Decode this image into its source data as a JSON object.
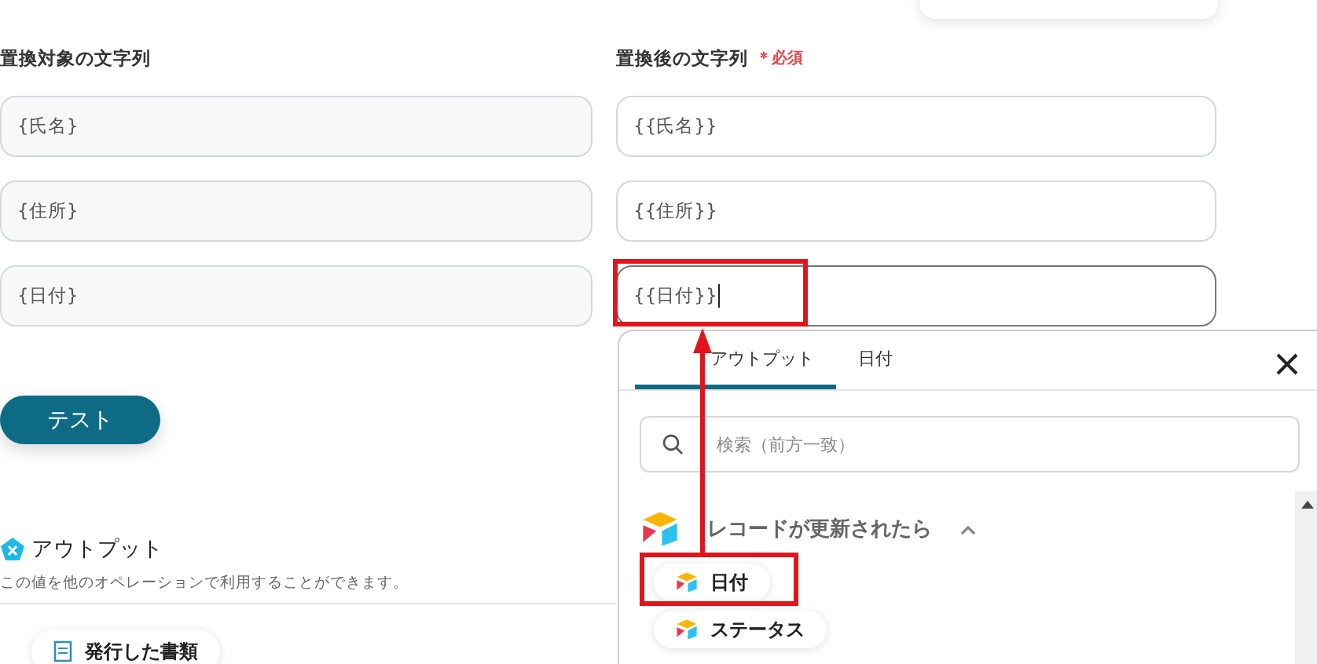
{
  "source_column": {
    "label": "置換対象の文字列",
    "fields": [
      {
        "value": "{氏名}",
        "focused": false
      },
      {
        "value": "{住所}",
        "focused": false
      },
      {
        "value": "{日付}",
        "focused": false
      }
    ]
  },
  "target_column": {
    "label": "置換後の文字列",
    "required_mark": "＊必須",
    "fields": [
      {
        "value": "{{氏名}}",
        "focused": false
      },
      {
        "value": "{{住所}}",
        "focused": false
      },
      {
        "value": "{{日付}}",
        "focused": true
      }
    ]
  },
  "test_button": "テスト",
  "output_section": {
    "title": "アウトプット",
    "description": "この値を他のオペレーションで利用することができます。",
    "items": [
      "発行した書類"
    ]
  },
  "picker": {
    "tabs": [
      {
        "label": "アウトプット",
        "selected": true
      },
      {
        "label": "日付",
        "selected": false
      }
    ],
    "search": {
      "placeholder": "検索（前方一致）"
    },
    "group": {
      "title": "レコードが更新されたら",
      "expanded": true,
      "items": [
        "日付",
        "ステータス"
      ]
    }
  }
}
